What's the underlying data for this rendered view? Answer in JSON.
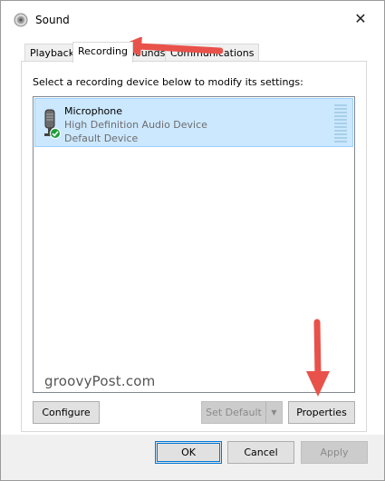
{
  "window": {
    "title": "Sound",
    "close_glyph": "✕"
  },
  "tabs": [
    {
      "label": "Playback",
      "active": false
    },
    {
      "label": "Recording",
      "active": true
    },
    {
      "label": "Sounds",
      "active": false
    },
    {
      "label": "Communications",
      "active": false
    }
  ],
  "panel": {
    "instruction": "Select a recording device below to modify its settings:"
  },
  "devices": [
    {
      "name": "Microphone",
      "description": "High Definition Audio Device",
      "status": "Default Device",
      "icon": "microphone-icon",
      "status_icon": "checkmark-icon"
    }
  ],
  "watermark": "groovyPost.com",
  "buttons": {
    "configure": "Configure",
    "set_default": "Set Default",
    "properties": "Properties",
    "ok": "OK",
    "cancel": "Cancel",
    "apply": "Apply"
  },
  "colors": {
    "selection_bg": "#cce8ff",
    "selection_border": "#99d1ff",
    "annotation_arrow": "#e8524a",
    "default_button_border": "#0078d7"
  }
}
